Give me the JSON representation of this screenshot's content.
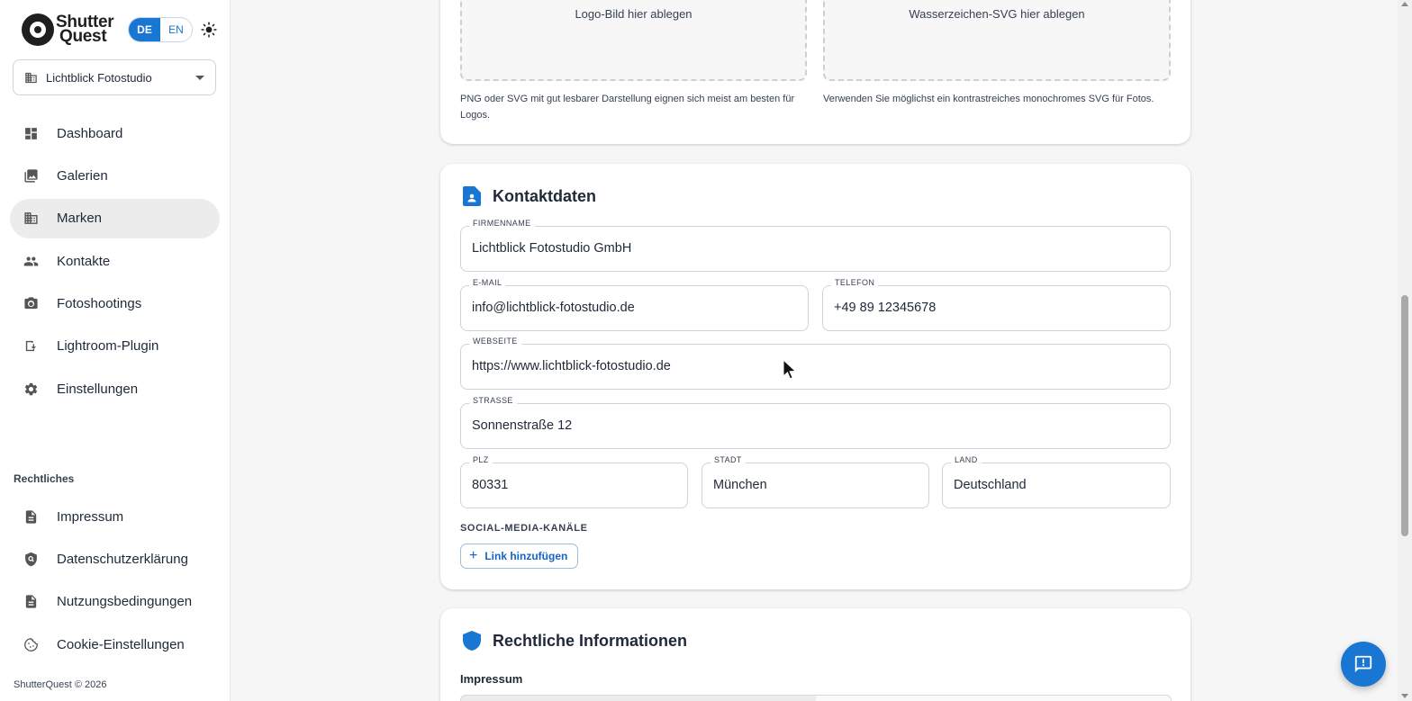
{
  "brand": {
    "line1": "Shutter",
    "line2": "Quest"
  },
  "language": {
    "active": "DE",
    "inactive": "EN"
  },
  "studio_select": {
    "value": "Lichtblick Fotostudio"
  },
  "nav": [
    {
      "label": "Dashboard",
      "icon": "dashboard-icon"
    },
    {
      "label": "Galerien",
      "icon": "gallery-icon"
    },
    {
      "label": "Marken",
      "icon": "building-icon",
      "active": true
    },
    {
      "label": "Kontakte",
      "icon": "people-icon"
    },
    {
      "label": "Fotoshootings",
      "icon": "camera-icon"
    },
    {
      "label": "Lightroom-Plugin",
      "icon": "plugin-download-icon"
    },
    {
      "label": "Einstellungen",
      "icon": "gear-icon"
    }
  ],
  "legal_section": {
    "label": "Rechtliches"
  },
  "legal_nav": [
    {
      "label": "Impressum",
      "icon": "document-icon"
    },
    {
      "label": "Datenschutzerklärung",
      "icon": "shield-search-icon"
    },
    {
      "label": "Nutzungsbedingungen",
      "icon": "document-icon"
    },
    {
      "label": "Cookie-Einstellungen",
      "icon": "cookie-icon"
    }
  ],
  "copyright": "ShutterQuest © 2026",
  "upload": {
    "logo_drop": "Logo-Bild hier ablegen",
    "watermark_drop": "Wasserzeichen-SVG hier ablegen",
    "logo_hint": "PNG oder SVG mit gut lesbarer Darstellung eignen sich meist am besten für Logos.",
    "watermark_hint": "Verwenden Sie möglichst ein kontrastreiches monochromes SVG für Fotos."
  },
  "contact": {
    "title": "Kontaktdaten",
    "company": {
      "label": "Firmenname",
      "value": "Lichtblick Fotostudio GmbH"
    },
    "email": {
      "label": "E-Mail",
      "value": "info@lichtblick-fotostudio.de"
    },
    "phone": {
      "label": "Telefon",
      "value": "+49 89 12345678"
    },
    "website": {
      "label": "Webseite",
      "value": "https://www.lichtblick-fotostudio.de"
    },
    "street": {
      "label": "Strasse",
      "value": "Sonnenstraße 12"
    },
    "zip": {
      "label": "PLZ",
      "value": "80331"
    },
    "city": {
      "label": "Stadt",
      "value": "München"
    },
    "country": {
      "label": "Land",
      "value": "Deutschland"
    },
    "social_label": "SOCIAL-MEDIA-KANÄLE",
    "add_link": "Link hinzufügen"
  },
  "legal_info": {
    "title": "Rechtliche Informationen",
    "impressum": "Impressum"
  },
  "colors": {
    "accent": "#1976d2",
    "active_nav": "#ececec"
  }
}
